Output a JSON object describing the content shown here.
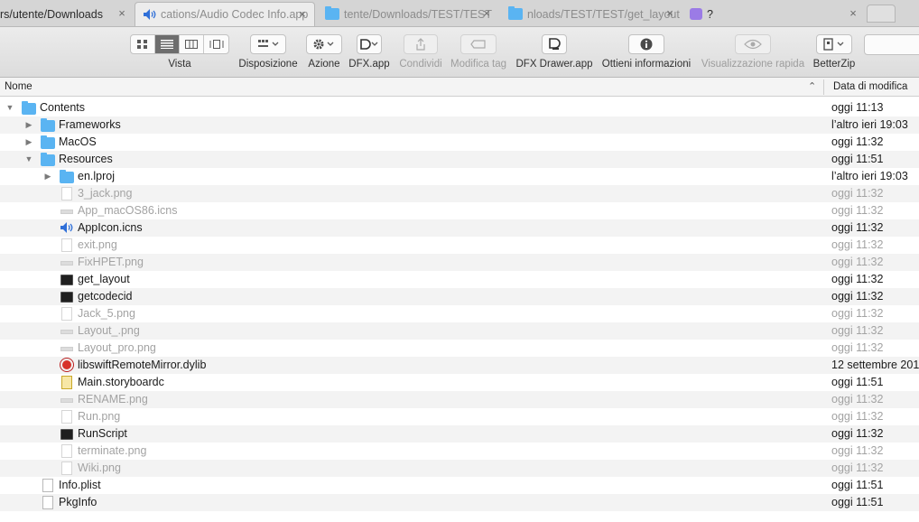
{
  "tabs": [
    {
      "label": "rs/utente/Downloads",
      "active": false,
      "icon": "none"
    },
    {
      "label": "cations/Audio Codec Info.app",
      "active": true,
      "icon": "speaker-icon"
    },
    {
      "label": "tente/Downloads/TEST/TEST",
      "active": false,
      "icon": "folder-icon"
    },
    {
      "label": "nloads/TEST/TEST/get_layout",
      "active": false,
      "icon": "folder-icon"
    },
    {
      "label": "?",
      "active": false,
      "icon": "app-icon"
    }
  ],
  "toolbar": {
    "view_label": "Vista",
    "arrange_label": "Disposizione",
    "action_label": "Azione",
    "dfx_label": "DFX.app",
    "share_label": "Condividi",
    "edit_tags_label": "Modifica tag",
    "dfx_drawer_label": "DFX Drawer.app",
    "get_info_label": "Ottieni informazioni",
    "quick_look_label": "Visualizzazione rapida",
    "betterzip_label": "BetterZip"
  },
  "columns": {
    "name": "Nome",
    "date_modified": "Data di modifica"
  },
  "rows": [
    {
      "name": "Contents",
      "date": "oggi 11:13",
      "indent": 0,
      "disclosure": "open",
      "icon": "folder",
      "dim": false
    },
    {
      "name": "Frameworks",
      "date": "l’altro ieri 19:03",
      "indent": 1,
      "disclosure": "closed",
      "icon": "folder",
      "dim": false
    },
    {
      "name": "MacOS",
      "date": "oggi 11:32",
      "indent": 1,
      "disclosure": "closed",
      "icon": "folder",
      "dim": false
    },
    {
      "name": "Resources",
      "date": "oggi 11:51",
      "indent": 1,
      "disclosure": "open",
      "icon": "folder",
      "dim": false
    },
    {
      "name": "en.lproj",
      "date": "l’altro ieri 19:03",
      "indent": 2,
      "disclosure": "closed",
      "icon": "folder",
      "dim": false
    },
    {
      "name": "3_jack.png",
      "date": "oggi 11:32",
      "indent": 2,
      "disclosure": "none",
      "icon": "image",
      "dim": true
    },
    {
      "name": "App_macOS86.icns",
      "date": "oggi 11:32",
      "indent": 2,
      "disclosure": "none",
      "icon": "strip",
      "dim": true
    },
    {
      "name": "AppIcon.icns",
      "date": "oggi 11:32",
      "indent": 2,
      "disclosure": "none",
      "icon": "speaker",
      "dim": false
    },
    {
      "name": "exit.png",
      "date": "oggi 11:32",
      "indent": 2,
      "disclosure": "none",
      "icon": "image",
      "dim": true
    },
    {
      "name": "FixHPET.png",
      "date": "oggi 11:32",
      "indent": 2,
      "disclosure": "none",
      "icon": "strip",
      "dim": true
    },
    {
      "name": "get_layout",
      "date": "oggi 11:32",
      "indent": 2,
      "disclosure": "none",
      "icon": "terminal",
      "dim": false
    },
    {
      "name": "getcodecid",
      "date": "oggi 11:32",
      "indent": 2,
      "disclosure": "none",
      "icon": "terminal",
      "dim": false
    },
    {
      "name": "Jack_5.png",
      "date": "oggi 11:32",
      "indent": 2,
      "disclosure": "none",
      "icon": "image",
      "dim": true
    },
    {
      "name": "Layout_.png",
      "date": "oggi 11:32",
      "indent": 2,
      "disclosure": "none",
      "icon": "strip",
      "dim": true
    },
    {
      "name": "Layout_pro.png",
      "date": "oggi 11:32",
      "indent": 2,
      "disclosure": "none",
      "icon": "strip",
      "dim": true
    },
    {
      "name": "libswiftRemoteMirror.dylib",
      "date": "12 settembre 201",
      "indent": 2,
      "disclosure": "none",
      "icon": "dylib",
      "dim": false
    },
    {
      "name": "Main.storyboardc",
      "date": "oggi 11:51",
      "indent": 2,
      "disclosure": "none",
      "icon": "storyboard",
      "dim": false
    },
    {
      "name": "RENAME.png",
      "date": "oggi 11:32",
      "indent": 2,
      "disclosure": "none",
      "icon": "strip",
      "dim": true
    },
    {
      "name": "Run.png",
      "date": "oggi 11:32",
      "indent": 2,
      "disclosure": "none",
      "icon": "image",
      "dim": true
    },
    {
      "name": "RunScript",
      "date": "oggi 11:32",
      "indent": 2,
      "disclosure": "none",
      "icon": "terminal",
      "dim": false
    },
    {
      "name": "terminate.png",
      "date": "oggi 11:32",
      "indent": 2,
      "disclosure": "none",
      "icon": "image",
      "dim": true
    },
    {
      "name": "Wiki.png",
      "date": "oggi 11:32",
      "indent": 2,
      "disclosure": "none",
      "icon": "image",
      "dim": true
    },
    {
      "name": "Info.plist",
      "date": "oggi 11:51",
      "indent": 1,
      "disclosure": "none",
      "icon": "doc",
      "dim": false
    },
    {
      "name": "PkgInfo",
      "date": "oggi 11:51",
      "indent": 1,
      "disclosure": "none",
      "icon": "doc",
      "dim": false
    }
  ],
  "colors": {
    "folder": "#5ab4f2",
    "dim_text": "#a3a3a3",
    "speaker": "#2f6fd8"
  }
}
